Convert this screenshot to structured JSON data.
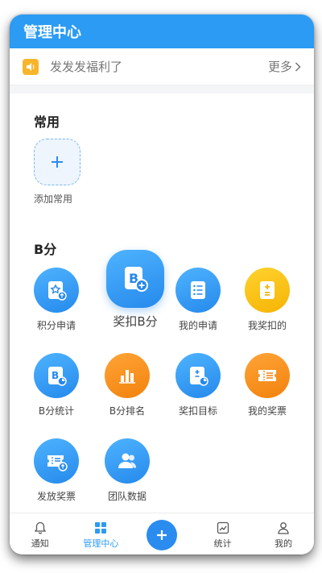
{
  "header": {
    "title": "管理中心"
  },
  "notice": {
    "text": "发发发福利了",
    "more_label": "更多"
  },
  "common": {
    "title": "常用",
    "add_label": "添加常用"
  },
  "bscore": {
    "title": "B分",
    "items": [
      {
        "label": "积分申请",
        "icon": "star-card-icon",
        "color": "blue"
      },
      {
        "label": "奖扣B分",
        "icon": "b-plus-icon",
        "color": "blue"
      },
      {
        "label": "我的申请",
        "icon": "list-icon",
        "color": "blue"
      },
      {
        "label": "我奖扣的",
        "icon": "plus-minus-icon",
        "color": "yellow"
      },
      {
        "label": "B分统计",
        "icon": "b-chart-icon",
        "color": "blue"
      },
      {
        "label": "B分排名",
        "icon": "bar-chart-icon",
        "color": "orange"
      },
      {
        "label": "奖扣目标",
        "icon": "target-icon",
        "color": "blue"
      },
      {
        "label": "我的奖票",
        "icon": "ticket-icon",
        "color": "orange"
      },
      {
        "label": "发放奖票",
        "icon": "send-ticket-icon",
        "color": "blue"
      },
      {
        "label": "团队数据",
        "icon": "team-icon",
        "color": "blue"
      }
    ]
  },
  "tabbar": {
    "items": [
      {
        "label": "通知",
        "icon": "bell-icon"
      },
      {
        "label": "管理中心",
        "icon": "grid-icon",
        "active": true
      },
      {
        "label": "",
        "icon": "plus-icon"
      },
      {
        "label": "统计",
        "icon": "stats-icon"
      },
      {
        "label": "我的",
        "icon": "user-icon"
      }
    ]
  },
  "colors": {
    "accent": "#2b9bf4",
    "orange": "#f2820d",
    "yellow": "#f5b405"
  }
}
